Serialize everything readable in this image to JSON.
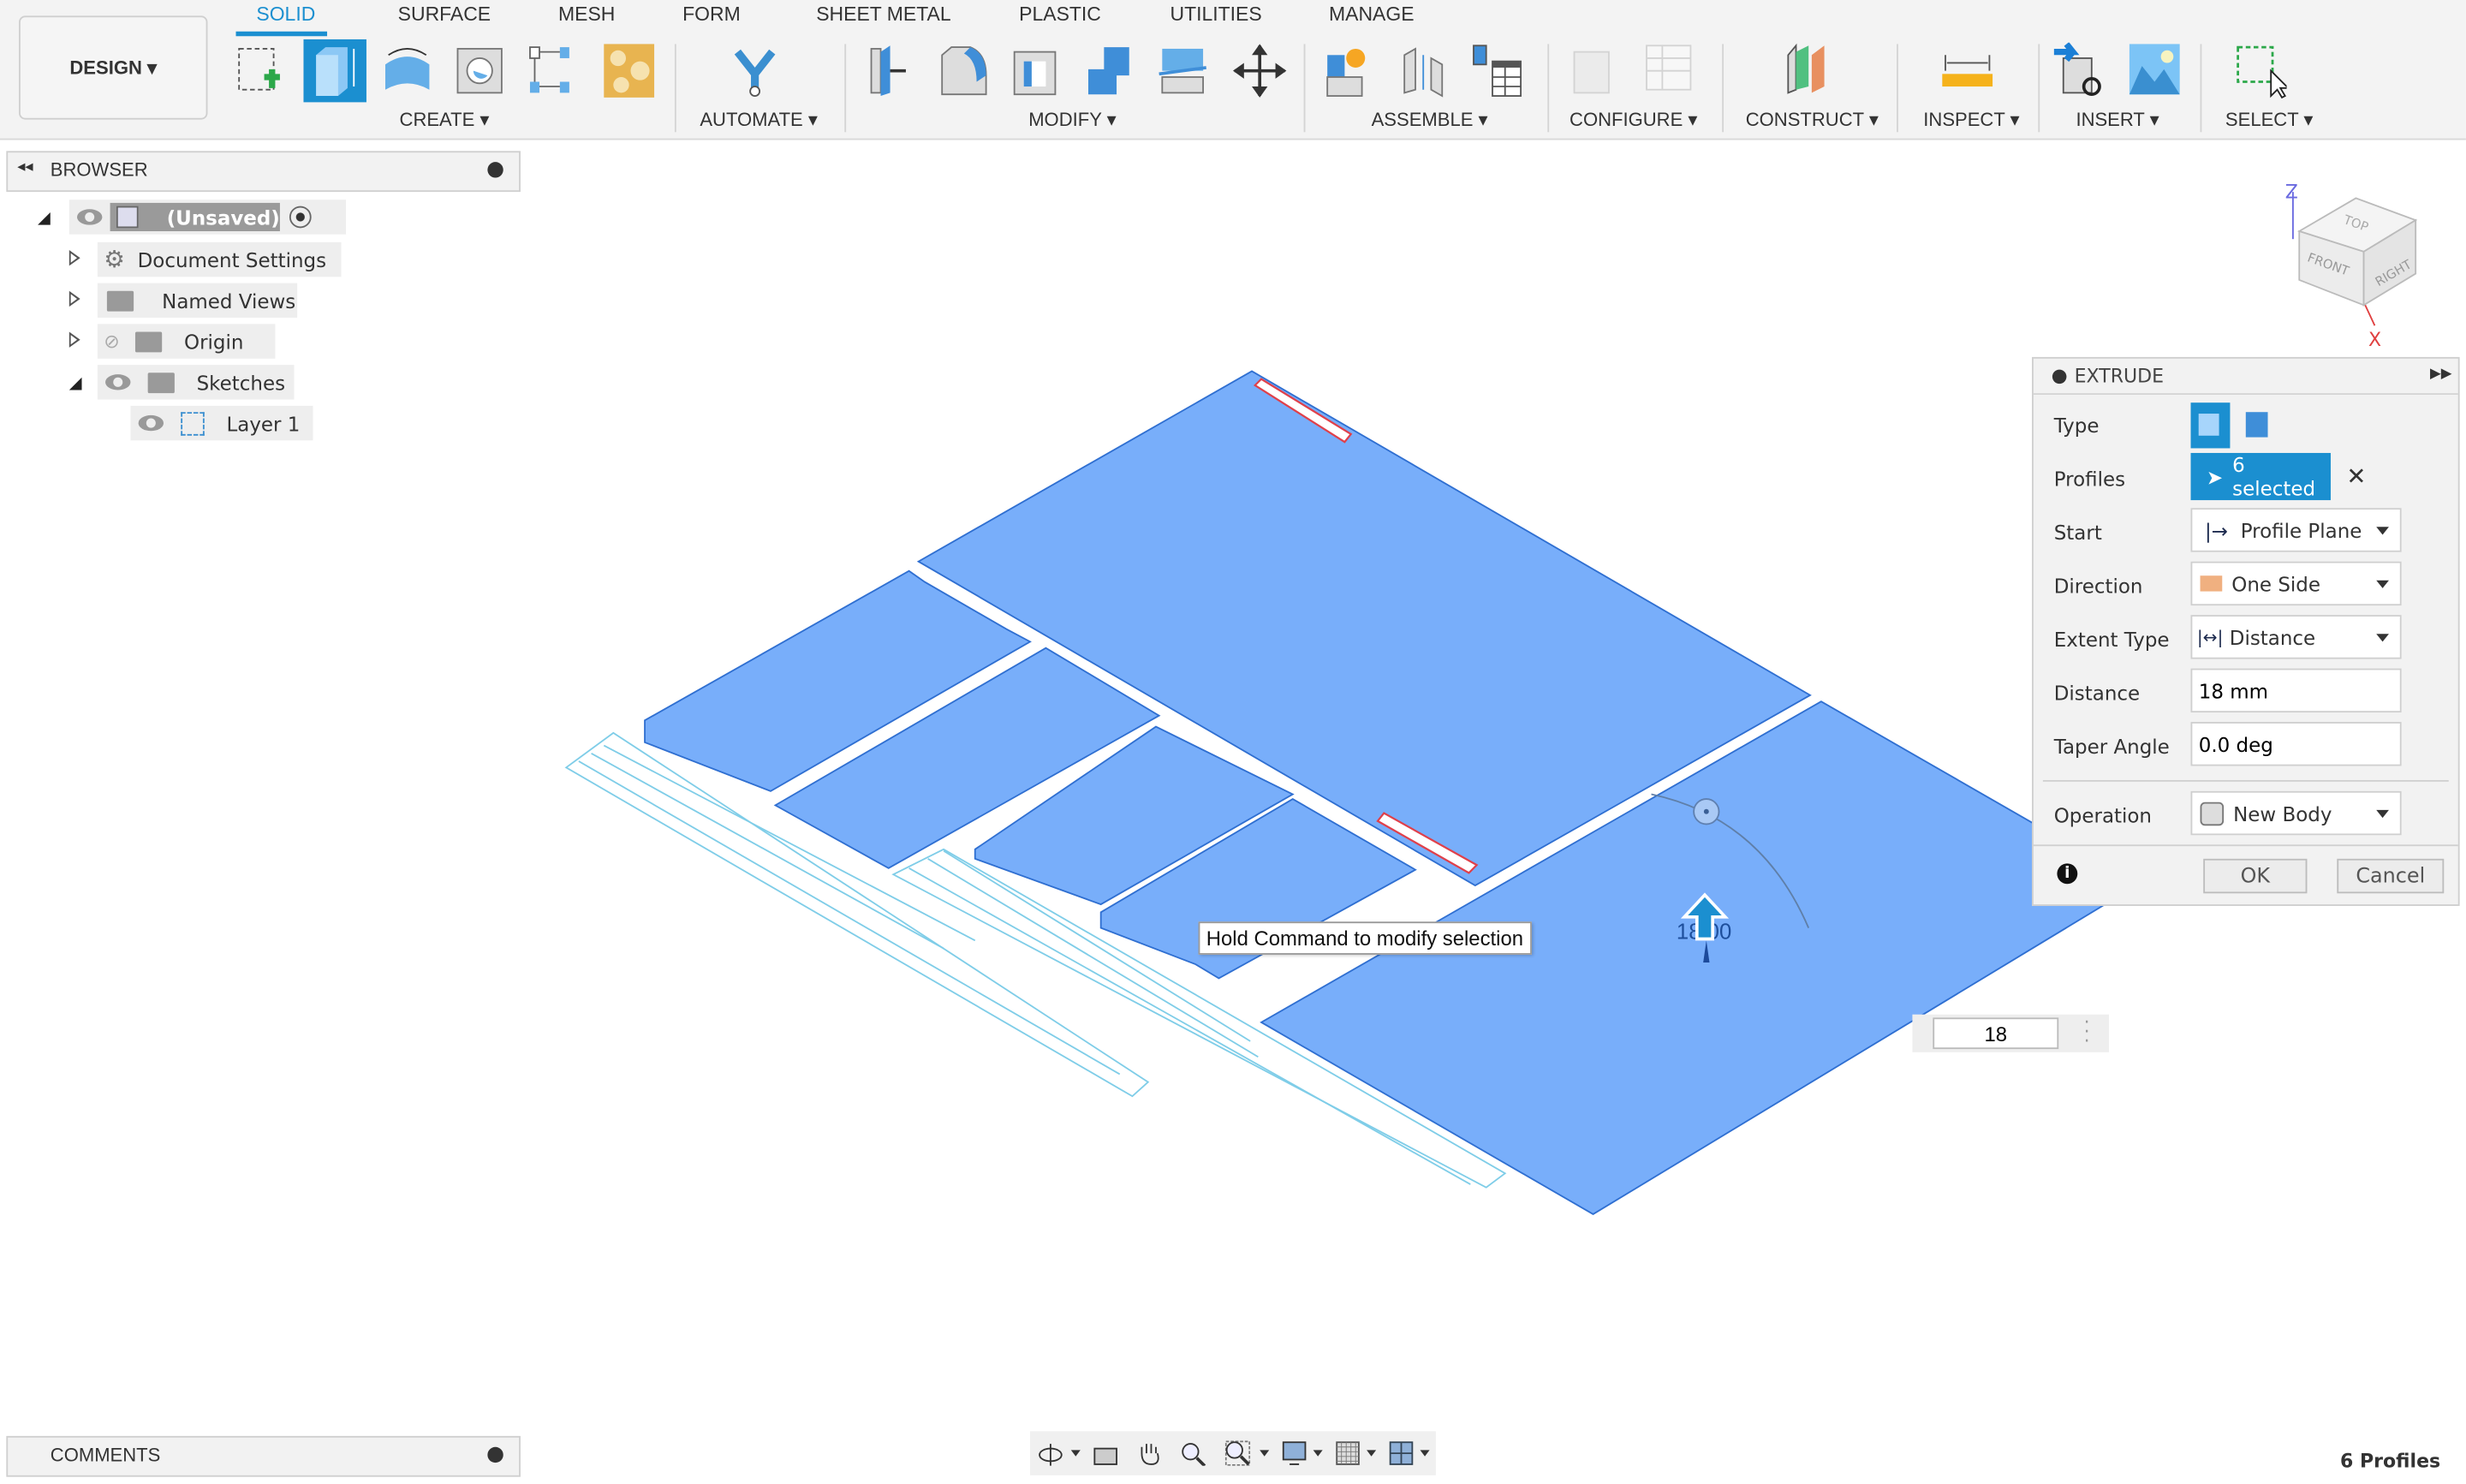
{
  "workspace": {
    "label": "DESIGN ▾"
  },
  "tabs": [
    {
      "label": "SOLID",
      "active": true
    },
    {
      "label": "SURFACE"
    },
    {
      "label": "MESH"
    },
    {
      "label": "FORM"
    },
    {
      "label": "SHEET METAL"
    },
    {
      "label": "PLASTIC"
    },
    {
      "label": "UTILITIES"
    },
    {
      "label": "MANAGE"
    }
  ],
  "groups": {
    "create": "CREATE ▾",
    "automate": "AUTOMATE ▾",
    "modify": "MODIFY ▾",
    "assemble": "ASSEMBLE ▾",
    "configure": "CONFIGURE ▾",
    "construct": "CONSTRUCT ▾",
    "inspect": "INSPECT ▾",
    "insert": "INSERT ▾",
    "select": "SELECT ▾"
  },
  "browser": {
    "title": "BROWSER",
    "root": "(Unsaved)",
    "items": [
      {
        "label": "Document Settings"
      },
      {
        "label": "Named Views"
      },
      {
        "label": "Origin"
      },
      {
        "label": "Sketches"
      },
      {
        "label": "Layer 1"
      }
    ]
  },
  "viewcube": {
    "top": "TOP",
    "front": "FRONT",
    "right": "RIGHT",
    "z": "Z",
    "x": "X"
  },
  "extrude": {
    "title": "EXTRUDE",
    "type_label": "Type",
    "profiles_label": "Profiles",
    "profiles_value": "6 selected",
    "start_label": "Start",
    "start_value": "Profile Plane",
    "direction_label": "Direction",
    "direction_value": "One Side",
    "extent_label": "Extent Type",
    "extent_value": "Distance",
    "distance_label": "Distance",
    "distance_value": "18 mm",
    "taper_label": "Taper Angle",
    "taper_value": "0.0 deg",
    "operation_label": "Operation",
    "operation_value": "New Body",
    "ok": "OK",
    "cancel": "Cancel"
  },
  "canvas": {
    "tooltip": "Hold Command to modify selection",
    "manipulator_value": "18.00",
    "inline_input_value": "18",
    "colors": {
      "profile_fill": "#78aefa",
      "profile_edge": "#2f6fd1",
      "sketch_line": "#7fcde8",
      "slot": "#e0404a"
    }
  },
  "comments": {
    "title": "COMMENTS"
  },
  "status": {
    "text": "6 Profiles"
  }
}
